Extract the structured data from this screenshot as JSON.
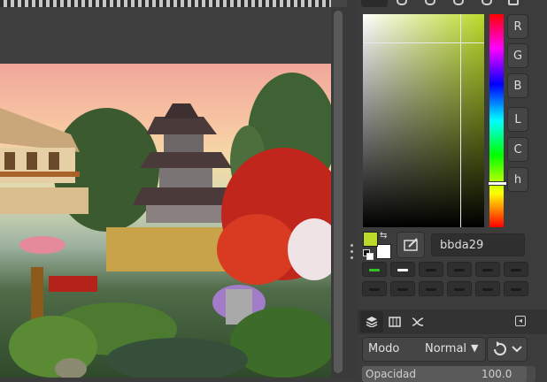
{
  "app": {
    "accent": "#bbda29"
  },
  "color_panel": {
    "channels": [
      "R",
      "G",
      "B",
      "L",
      "C",
      "h"
    ],
    "hex_value": "bbda29",
    "fg_color": "#bbda29",
    "bg_color": "#ffffff",
    "history_colors": [
      "#31c42a",
      "#ffffff",
      "#1a1a1a",
      "#1a1a1a",
      "#1a1a1a",
      "#1a1a1a",
      "#1a1a1a",
      "#1a1a1a",
      "#1a1a1a",
      "#1a1a1a",
      "#1a1a1a",
      "#1a1a1a"
    ]
  },
  "layers_panel": {
    "mode_label": "Modo",
    "mode_value": "Normal",
    "opacity_label": "Opacidad",
    "opacity_value": "100.0",
    "opacity": 100
  },
  "icons": [
    "layers-icon",
    "channels-icon",
    "paths-icon",
    "collapse-icon",
    "chevron-down-icon",
    "reset-icon",
    "color-picker-icon",
    "swap-colors-icon"
  ]
}
